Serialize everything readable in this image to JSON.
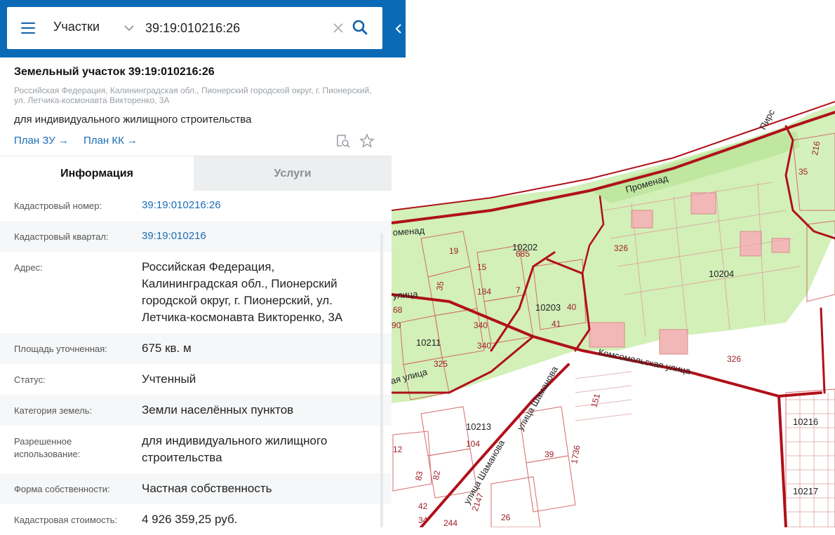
{
  "search": {
    "layer": "Участки",
    "query": "39:19:010216:26"
  },
  "parcel": {
    "title": "Земельный участок 39:19:010216:26",
    "address_short": "Российская Федерация, Калининградская обл., Пионерский городской округ, г. Пионерский, ул. Летчика-космонавта Викторенко, 3А",
    "purpose": "для индивидуального жилищного строительства",
    "plan_zu": "План ЗУ",
    "plan_kk": "План КК",
    "arrow": "→"
  },
  "tabs": [
    {
      "label": "Информация",
      "active": true
    },
    {
      "label": "Услуги",
      "active": false
    }
  ],
  "info_rows": [
    {
      "label": "Кадастровый номер:",
      "value": "39:19:010216:26",
      "link": true
    },
    {
      "label": "Кадастровый квартал:",
      "value": "39:19:010216",
      "link": true
    },
    {
      "label": "Адрес:",
      "value": "Российская Федерация, Калининградская обл., Пионерский городской округ, г. Пионерский, ул. Летчика-космонавта Викторенко, 3А",
      "link": false
    },
    {
      "label": "Площадь уточненная:",
      "value": "675 кв. м",
      "link": false
    },
    {
      "label": "Статус:",
      "value": "Учтенный",
      "link": false
    },
    {
      "label": "Категория земель:",
      "value": "Земли населённых пунктов",
      "link": false
    },
    {
      "label": "Разрешенное использование:",
      "value": "для индивидуального жилищного строительства",
      "link": false
    },
    {
      "label": "Форма собственности:",
      "value": "Частная собственность",
      "link": false
    },
    {
      "label": "Кадастровая стоимость:",
      "value": "4 926 359,25 руб.",
      "link": false
    }
  ],
  "map": {
    "labels": {
      "pirs": "Пирс",
      "promenad": "Променад",
      "promenad2": "оменад",
      "komsomolskaya": "Комсомольская улица",
      "shamanova1": "улица Шаманова",
      "shamanova2": "улица Шаманова",
      "ulitsa_left": "улица",
      "ulitsa_left2": "ая улица",
      "q10202": "10202",
      "q10203": "10203",
      "q10204": "10204",
      "q10211": "10211",
      "q10213": "10213",
      "q10216": "10216",
      "q10217": "10217",
      "n685": "685",
      "n326a": "326",
      "n326b": "326",
      "n19": "19",
      "n15": "15",
      "n35a": "35",
      "n184": "184",
      "n7": "7",
      "n40": "40",
      "n41": "41",
      "n340a": "340",
      "n340b": "340",
      "n325": "325",
      "n68": "68",
      "n90": "90",
      "n104": "104",
      "n39": "39",
      "n1736": "1736",
      "n83": "83",
      "n82": "82",
      "n42": "42",
      "n2147": "2147",
      "n26": "26",
      "n12": "12",
      "n35b": "35",
      "n216": "216",
      "n151": "151",
      "n34": "34",
      "n244": "244"
    },
    "colors": {
      "green": "#cdeeb0",
      "road": "#b0101a",
      "parcel": "#d88a8a",
      "accent": "#0a6ab6"
    }
  }
}
